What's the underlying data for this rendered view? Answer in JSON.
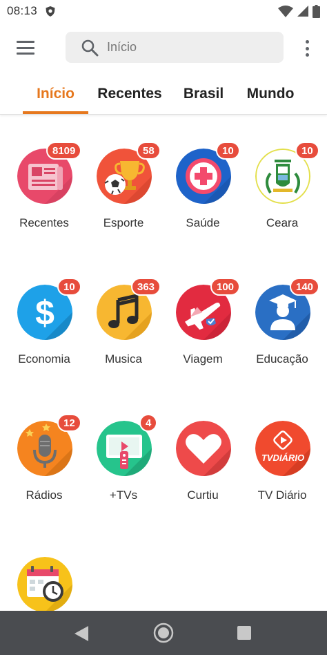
{
  "status_bar": {
    "time": "08:13",
    "icons": [
      "shield-icon",
      "wifi-icon",
      "signal-icon",
      "battery-icon"
    ]
  },
  "top_bar": {
    "menu_icon": "hamburger-menu-icon",
    "search_placeholder": "Início",
    "more_icon": "more-vert-icon"
  },
  "tabs": [
    {
      "label": "Início",
      "active": true
    },
    {
      "label": "Recentes",
      "active": false
    },
    {
      "label": "Brasil",
      "active": false
    },
    {
      "label": "Mundo",
      "active": false
    }
  ],
  "categories": [
    {
      "label": "Recentes",
      "badge": "8109",
      "icon": "newspaper-icon",
      "color": "#e8496a"
    },
    {
      "label": "Esporte",
      "badge": "58",
      "icon": "trophy-ball-icon",
      "color": "#f0533a"
    },
    {
      "label": "Saúde",
      "badge": "10",
      "icon": "health-cross-icon",
      "color": "#1e63c9"
    },
    {
      "label": "Ceara",
      "badge": "10",
      "icon": "ceara-coat-of-arms-icon",
      "color": "#ffffff"
    },
    {
      "label": "Economia",
      "badge": "10",
      "icon": "dollar-icon",
      "color": "#1ea1e8"
    },
    {
      "label": "Musica",
      "badge": "363",
      "icon": "music-note-icon",
      "color": "#f7b731"
    },
    {
      "label": "Viagem",
      "badge": "100",
      "icon": "airplane-icon",
      "color": "#e22b40"
    },
    {
      "label": "Educação",
      "badge": "140",
      "icon": "graduate-icon",
      "color": "#2a6fc4"
    },
    {
      "label": "Rádios",
      "badge": "12",
      "icon": "microphone-icon",
      "color": "#f5841f"
    },
    {
      "label": "+TVs",
      "badge": "4",
      "icon": "tv-remote-icon",
      "color": "#26c48c"
    },
    {
      "label": "Curtiu",
      "badge": "",
      "icon": "heart-icon",
      "color": "#ee4a4a"
    },
    {
      "label": "TV Diário",
      "badge": "",
      "icon": "tv-diario-logo-icon",
      "color": "#f04a2e"
    },
    {
      "label": "",
      "badge": "",
      "icon": "calendar-clock-icon",
      "color": "#f7c21a"
    }
  ],
  "tv_diario_logo_text": "TVDIÁRIO",
  "nav_bar": {
    "back_icon": "back-triangle-icon",
    "home_icon": "home-circle-icon",
    "recents_icon": "recents-square-icon"
  }
}
